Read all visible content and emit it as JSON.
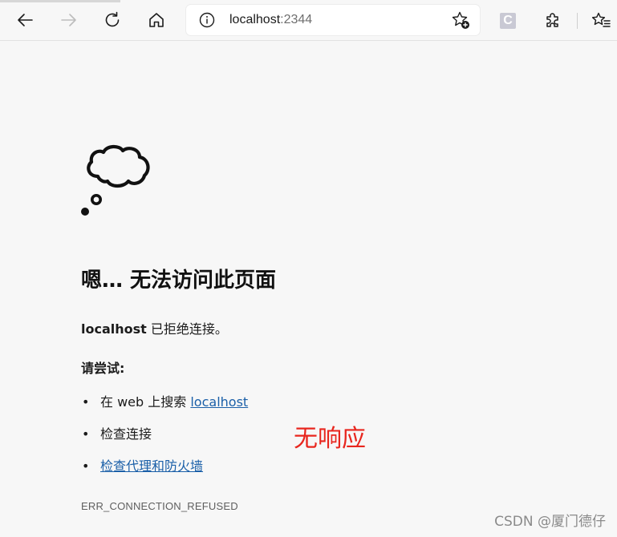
{
  "browser": {
    "address_bar": {
      "host": "localhost",
      "port": ":2344"
    },
    "extension_badge": "C",
    "icons": {
      "back": "arrow-left-icon",
      "forward": "arrow-right-icon",
      "refresh": "refresh-icon",
      "home": "home-icon",
      "site_info": "info-icon",
      "add_favorite": "star-plus-icon",
      "extensions": "puzzle-icon",
      "favorites": "favorites-list-icon"
    }
  },
  "error_page": {
    "icon": "thought-cloud-icon",
    "title": "嗯… 无法访问此页面",
    "host": "localhost",
    "message": " 已拒绝连接。",
    "try_heading": "请尝试:",
    "suggestions": {
      "search_prefix": "在 web 上搜索 ",
      "search_link": "localhost",
      "check_connection": "检查连接",
      "check_proxy_link": "检查代理和防火墙"
    },
    "bullet": "•",
    "error_code": "ERR_CONNECTION_REFUSED"
  },
  "annotation": {
    "text": "无响应",
    "color": "#e8261e"
  },
  "watermark": "CSDN @厦门德仔",
  "colors": {
    "link": "#1a5fa8",
    "background": "#f7f7f7"
  }
}
